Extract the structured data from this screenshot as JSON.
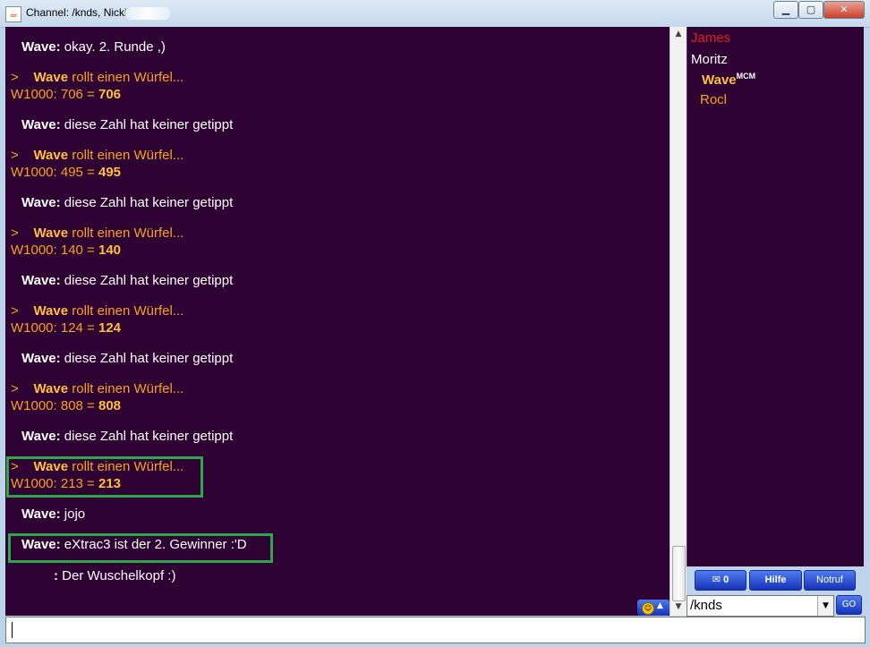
{
  "window": {
    "title": "Channel: /knds,  Nicki",
    "minimize_label": "▁",
    "maximize_label": "▢",
    "close_label": "✕",
    "app_icon_glyph": "☕"
  },
  "chat": {
    "messages": [
      {
        "type": "say",
        "nick": "Wave:",
        "text": "okay. 2. Runde ,)"
      },
      {
        "type": "roll",
        "prompt": ">",
        "nick": "Wave",
        "action": "rollt einen Würfel...",
        "expr": "W1000: 706 = ",
        "result": "706"
      },
      {
        "type": "say",
        "nick": "Wave:",
        "text": "diese Zahl hat keiner getippt"
      },
      {
        "type": "roll",
        "prompt": ">",
        "nick": "Wave",
        "action": "rollt einen Würfel...",
        "expr": "W1000: 495 = ",
        "result": "495"
      },
      {
        "type": "say",
        "nick": "Wave:",
        "text": "diese Zahl hat keiner getippt"
      },
      {
        "type": "roll",
        "prompt": ">",
        "nick": "Wave",
        "action": "rollt einen Würfel...",
        "expr": "W1000: 140 = ",
        "result": "140"
      },
      {
        "type": "say",
        "nick": "Wave:",
        "text": "diese Zahl hat keiner getippt"
      },
      {
        "type": "roll",
        "prompt": ">",
        "nick": "Wave",
        "action": "rollt einen Würfel...",
        "expr": "W1000: 124 = ",
        "result": "124"
      },
      {
        "type": "say",
        "nick": "Wave:",
        "text": "diese Zahl hat keiner getippt"
      },
      {
        "type": "roll",
        "prompt": ">",
        "nick": "Wave",
        "action": "rollt einen Würfel...",
        "expr": "W1000: 808 = ",
        "result": "808"
      },
      {
        "type": "say",
        "nick": "Wave:",
        "text": "diese Zahl hat keiner getippt"
      },
      {
        "type": "roll",
        "prompt": ">",
        "nick": "Wave",
        "action": "rollt einen Würfel...",
        "expr": "W1000: 213 = ",
        "result": "213"
      },
      {
        "type": "say",
        "nick": "Wave:",
        "text": "jojo"
      },
      {
        "type": "say",
        "nick": "Wave:",
        "text": "eXtrac3 ist der 2. Gewinner :'D"
      },
      {
        "type": "say",
        "nick": ":",
        "text": "Der Wuschelkopf :)"
      }
    ]
  },
  "users": [
    {
      "name": "James",
      "badge": "",
      "color": "#e02020"
    },
    {
      "name": "Moritz",
      "badge": "",
      "color": "#ffffff"
    },
    {
      "name": "Wave",
      "badge": "MCM",
      "color": "#ffc03a"
    },
    {
      "name": "Rocl",
      "badge": "",
      "color": "#f6a321"
    }
  ],
  "controls": {
    "mail_icon": "✉",
    "mail_count": "0",
    "help_label": "Hilfe",
    "emergency_label": "Notruf",
    "channel_value": "/knds",
    "go_label": "GO",
    "smiley_glyph": "☺",
    "scroll_up_glyph": "▲",
    "dropdown_glyph": "▼"
  },
  "colors": {
    "chat_bg": "#2e0233",
    "nick_white": "#ffffff",
    "roll_orange": "#f6a321",
    "highlight_green": "#2fa64c",
    "button_blue": "#1532b8"
  }
}
